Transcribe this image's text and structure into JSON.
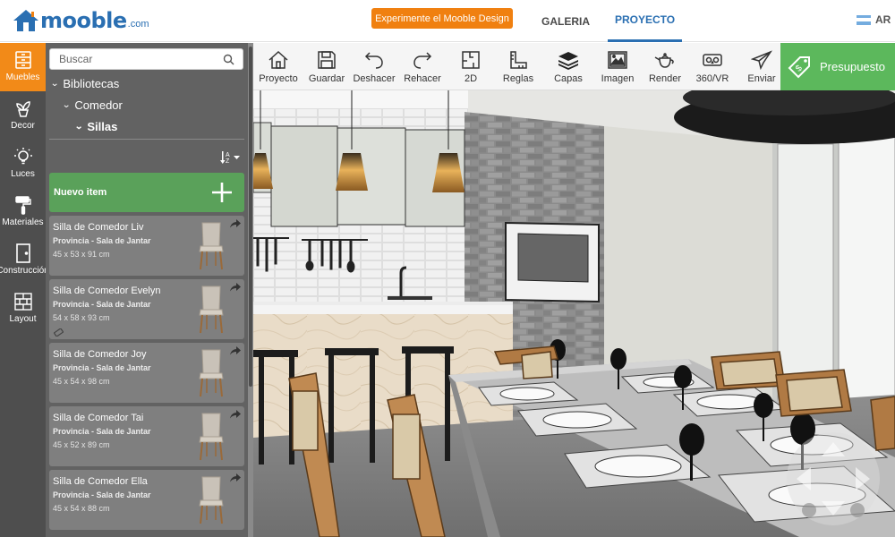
{
  "header": {
    "logo_text": "mooble",
    "logo_suffix": ".com",
    "promo_button": "Experimente el Mooble Design",
    "tabs": [
      "GALERIA",
      "PROYECTO"
    ],
    "active_tab": "PROYECTO",
    "language": "AR",
    "brand_color": "#2a6fb2",
    "promo_color": "#f08010"
  },
  "rail": {
    "items": [
      {
        "label": "Muebles",
        "icon": "cabinet-icon",
        "active": true
      },
      {
        "label": "Decor",
        "icon": "plant-icon",
        "active": false
      },
      {
        "label": "Luces",
        "icon": "bulb-icon",
        "active": false
      },
      {
        "label": "Materiales",
        "icon": "paint-roller-icon",
        "active": false
      },
      {
        "label": "Construcción",
        "icon": "door-icon",
        "active": false
      },
      {
        "label": "Layout",
        "icon": "brick-wall-icon",
        "active": false
      }
    ]
  },
  "library": {
    "search_placeholder": "Buscar",
    "tree": [
      "Bibliotecas",
      "Comedor",
      "Sillas"
    ],
    "new_item_label": "Nuevo item",
    "items": [
      {
        "title": "Silla de Comedor Liv",
        "source": "Provincia - Sala de Jantar",
        "size": "45 x 53 x 91 cm"
      },
      {
        "title": "Silla de Comedor Evelyn",
        "source": "Provincia - Sala de Jantar",
        "size": "54 x 58 x 93 cm"
      },
      {
        "title": "Silla de Comedor Joy",
        "source": "Provincia - Sala de Jantar",
        "size": "45 x 54 x 98 cm"
      },
      {
        "title": "Silla de Comedor Tai",
        "source": "Provincia - Sala de Jantar",
        "size": "45 x 52 x 89 cm"
      },
      {
        "title": "Silla de Comedor Ella",
        "source": "Provincia - Sala de Jantar",
        "size": "45 x 54 x 88 cm"
      }
    ]
  },
  "toolbar": {
    "tools": [
      {
        "label": "Proyecto",
        "icon": "home-icon"
      },
      {
        "label": "Guardar",
        "icon": "save-icon"
      },
      {
        "label": "Deshacer",
        "icon": "undo-icon"
      },
      {
        "label": "Rehacer",
        "icon": "redo-icon"
      },
      {
        "label": "2D",
        "icon": "floorplan-icon"
      },
      {
        "label": "Reglas",
        "icon": "ruler-icon"
      },
      {
        "label": "Capas",
        "icon": "layers-icon"
      },
      {
        "label": "Imagen",
        "icon": "image-icon"
      },
      {
        "label": "Render",
        "icon": "teapot-icon"
      },
      {
        "label": "360/VR",
        "icon": "vr-headset-icon"
      },
      {
        "label": "Enviar",
        "icon": "paper-plane-icon"
      }
    ],
    "budget_label": "Presupuesto",
    "budget_color": "#5cb85c"
  }
}
